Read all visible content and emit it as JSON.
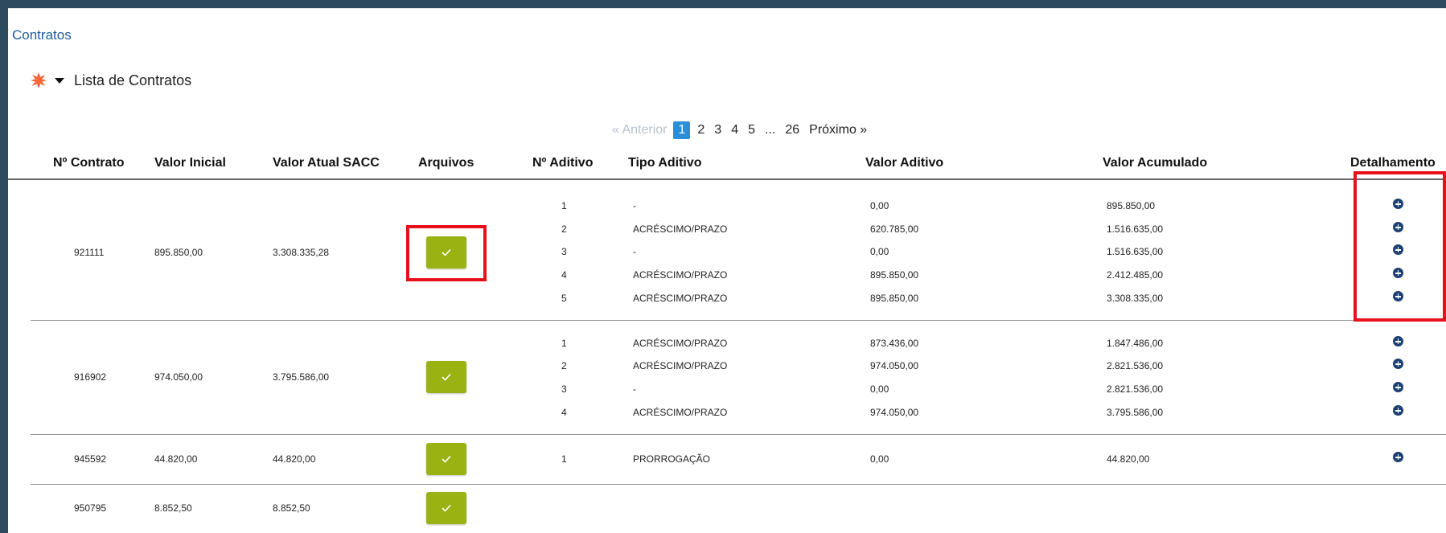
{
  "breadcrumb": "Contratos",
  "section": {
    "title": "Lista de Contratos",
    "icon": "red-burst-icon",
    "caret_icon": "caret-down-icon"
  },
  "pagination": {
    "prev": "« Anterior",
    "current": "1",
    "pages": [
      "2",
      "3",
      "4",
      "5",
      "...",
      "26"
    ],
    "next": "Próximo »"
  },
  "table": {
    "headers": {
      "contrato": "Nº Contrato",
      "valor_inicial": "Valor Inicial",
      "valor_atual": "Valor Atual SACC",
      "arquivos": "Arquivos",
      "aditivo": "Nº Aditivo",
      "tipo": "Tipo Aditivo",
      "valor_aditivo": "Valor Aditivo",
      "acumulado": "Valor Acumulado",
      "detalhamento": "Detalhamento"
    },
    "contracts": [
      {
        "numero": "921111",
        "valor_inicial": "895.850,00",
        "valor_atual": "3.308.335,28",
        "aditivos": [
          {
            "n": "1",
            "tipo": "-",
            "valor": "0,00",
            "acumulado": "895.850,00"
          },
          {
            "n": "2",
            "tipo": "ACRÉSCIMO/PRAZO",
            "valor": "620.785,00",
            "acumulado": "1.516.635,00"
          },
          {
            "n": "3",
            "tipo": "-",
            "valor": "0,00",
            "acumulado": "1.516.635,00"
          },
          {
            "n": "4",
            "tipo": "ACRÉSCIMO/PRAZO",
            "valor": "895.850,00",
            "acumulado": "2.412.485,00"
          },
          {
            "n": "5",
            "tipo": "ACRÉSCIMO/PRAZO",
            "valor": "895.850,00",
            "acumulado": "3.308.335,00"
          }
        ]
      },
      {
        "numero": "916902",
        "valor_inicial": "974.050,00",
        "valor_atual": "3.795.586,00",
        "aditivos": [
          {
            "n": "1",
            "tipo": "ACRÉSCIMO/PRAZO",
            "valor": "873.436,00",
            "acumulado": "1.847.486,00"
          },
          {
            "n": "2",
            "tipo": "ACRÉSCIMO/PRAZO",
            "valor": "974.050,00",
            "acumulado": "2.821.536,00"
          },
          {
            "n": "3",
            "tipo": "-",
            "valor": "0,00",
            "acumulado": "2.821.536,00"
          },
          {
            "n": "4",
            "tipo": "ACRÉSCIMO/PRAZO",
            "valor": "974.050,00",
            "acumulado": "3.795.586,00"
          }
        ]
      },
      {
        "numero": "945592",
        "valor_inicial": "44.820,00",
        "valor_atual": "44.820,00",
        "aditivos": [
          {
            "n": "1",
            "tipo": "PRORROGAÇÃO",
            "valor": "0,00",
            "acumulado": "44.820,00"
          }
        ]
      },
      {
        "numero": "950795",
        "valor_inicial": "8.852,50",
        "valor_atual": "8.852,50",
        "aditivos": []
      }
    ]
  },
  "colors": {
    "frame": "#2e4a5e",
    "link": "#1e5aa0",
    "file_button": "#9ab313",
    "detail_icon": "#1c3f73",
    "highlight": "#e8101a",
    "page_active": "#2a8fd8"
  }
}
